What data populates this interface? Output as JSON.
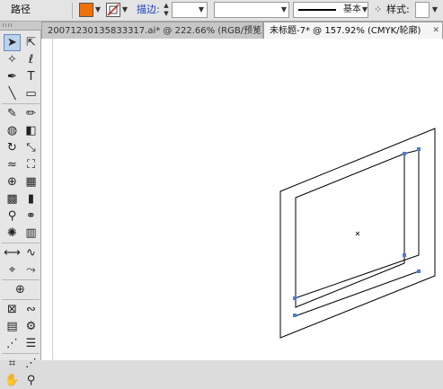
{
  "control_bar": {
    "path_label": "路径",
    "fill_color": "#f0700a",
    "stroke_label": "描边:",
    "stroke_weight": "",
    "stroke_style_name": "基本",
    "style_label": "样式:"
  },
  "tabs": [
    {
      "label": "20071230135833317.ai* @ 222.66% (RGB/预览)",
      "active": false
    },
    {
      "label": "未标题-7* @ 157.92% (CMYK/轮廓)",
      "active": true
    }
  ],
  "colors": {
    "selection_blue": "#4a7bd8",
    "outline": "#000000"
  },
  "tools": [
    "selection-tool",
    "direct-selection-tool",
    "magic-wand-tool",
    "lasso-tool",
    "pen-tool",
    "type-tool",
    "line-segment-tool",
    "rectangle-tool",
    "paintbrush-tool",
    "pencil-tool",
    "blob-brush-tool",
    "eraser-tool",
    "rotate-tool",
    "scale-tool",
    "warp-tool",
    "free-transform-tool",
    "shape-builder-tool",
    "perspective-grid-tool",
    "mesh-tool",
    "gradient-tool",
    "eyedropper-tool",
    "blend-tool",
    "symbol-sprayer-tool",
    "column-graph-tool",
    "width-tool",
    "reshape-tool",
    "anchor-tool",
    "curve-tool",
    "target-tool",
    "envelope-tool",
    "wave-tool",
    "grid-tool",
    "gear-tool",
    "graph-tool",
    "list-tool",
    "artboard-tool",
    "slice-tool",
    "hand-tool",
    "zoom-tool"
  ]
}
